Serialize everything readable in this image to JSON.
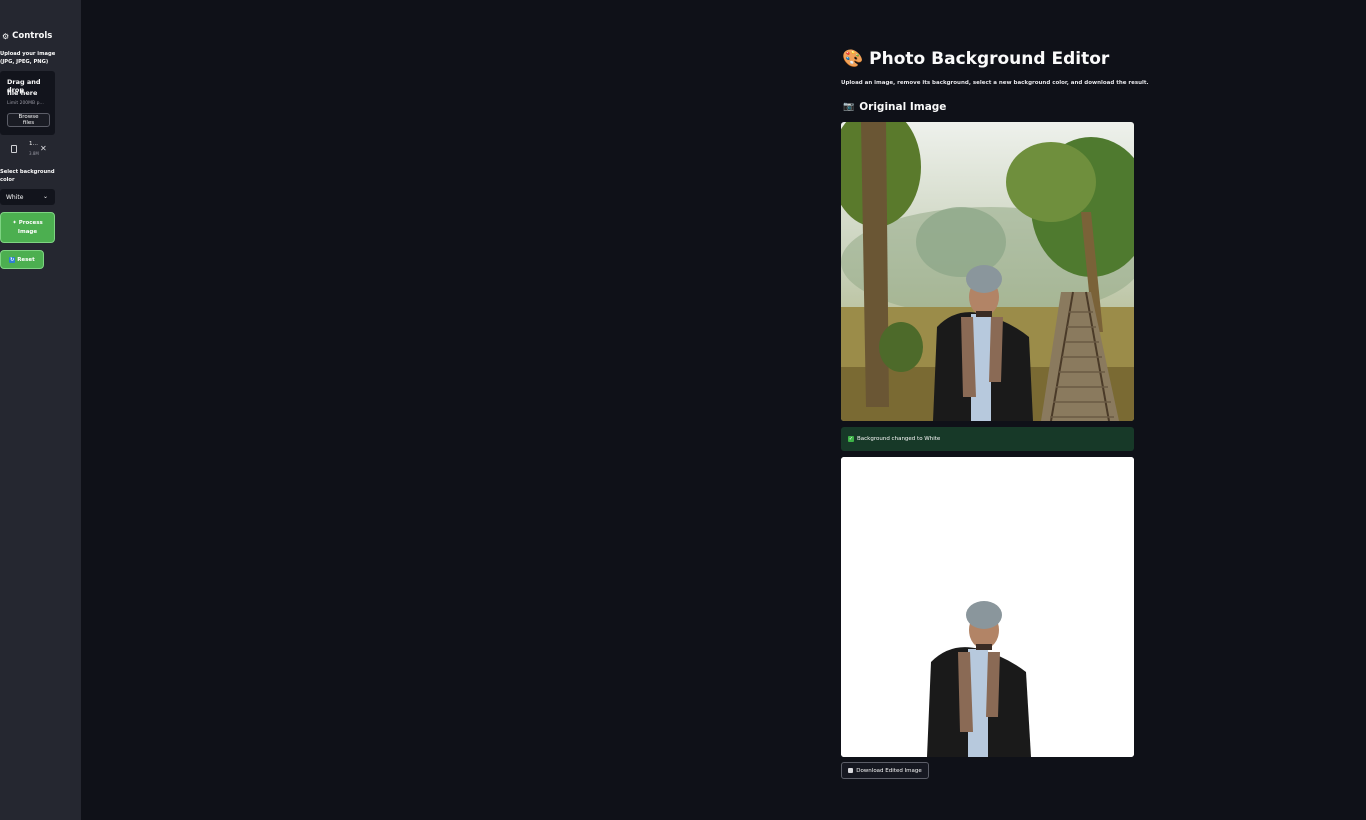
{
  "sidebar": {
    "title": "Controls",
    "upload_label": "Upload your image (JPG, JPEG, PNG)",
    "dropzone": {
      "line1": "Drag and drop",
      "line2": "file here",
      "limit": "Limit 200MB p…"
    },
    "browse_label": "Browse files",
    "file": {
      "name": "1…",
      "size": "3.8M"
    },
    "bg_label": "Select background color",
    "select_value": "White",
    "process_line1": "Process",
    "process_line2": "Image",
    "reset_label": "Reset"
  },
  "main": {
    "title": "Photo Background Editor",
    "subtitle": "Upload an image, remove its background, select a new background color, and download the result.",
    "section_title": "Original Image",
    "success_message": "Background changed to White",
    "download_label": "Download Edited Image"
  },
  "icons": {
    "sidebar_title": "gear-icon",
    "title": "palette-icon",
    "section": "camera-icon",
    "file": "file-icon",
    "close": "close-icon",
    "select": "chevron-down-icon",
    "process": "sparkle-icon",
    "reset": "refresh-icon",
    "success": "check-icon",
    "download": "download-icon"
  },
  "colors": {
    "app_bg": "#0f1118",
    "sidebar_bg": "#252730",
    "accent_green": "#4caf50",
    "success_bg": "#173928"
  }
}
